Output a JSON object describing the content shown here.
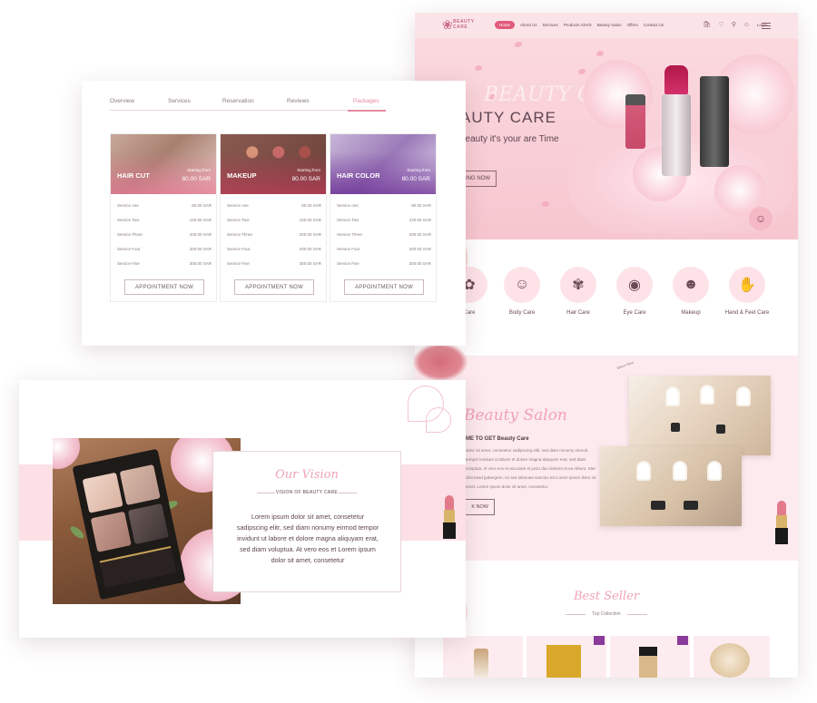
{
  "home": {
    "logo_text": "BEAUTY CARE",
    "nav": [
      "Home",
      "About Us",
      "Services",
      "Products ADVS",
      "Beauty Salon",
      "Offers",
      "Contact Us"
    ],
    "login": "Login",
    "hero_bg_word": "BEAUTY CARE",
    "hero_title": "AUTY CARE",
    "hero_subtitle": "beauty it's your are Time",
    "hero_button": "KING NOW",
    "categories": [
      "Care",
      "Body Care",
      "Hair Care",
      "Eye Care",
      "Makeup",
      "Hand & Feet Care"
    ],
    "salon_script": "Beauty Salon",
    "salon_heading": "ME TO GET Beauty Care",
    "salon_body": "dolor sit amet, consetetur sadipscing elitr, sed diam nonumy eirmod tempor invidunt ut labore et dolore magna aliquyam erat, sed diam voluptua. At vero eos et accusam et justo duo dolores et ea rebum. Stet clita kasd gubergren, no sea takimata sanctus est Lorem ipsum dolor sit amet. Lorem ipsum dolor sit amet, consetetur",
    "salon_button": "K NOW",
    "badge_text": "Since Now",
    "best_script": "Best Seller",
    "best_sub": "Top Collection",
    "colors": {
      "accent": "#e05a7a",
      "pink_bg": "#fbe4e8",
      "script": "#f0a3b5"
    }
  },
  "services": {
    "tabs": [
      "Overview",
      "Services",
      "Reservation",
      "Reviews",
      "Packages"
    ],
    "active_tab": "Packages",
    "packages": [
      {
        "name": "HAIR CUT",
        "from": "Starting from",
        "price": "80.00 SAR",
        "rows": [
          [
            "Service one",
            "80.00 SAR"
          ],
          [
            "Service Two",
            "120.00 SAR"
          ],
          [
            "Service Three",
            "200.00 SAR"
          ],
          [
            "Service Four",
            "200.00 SAR"
          ],
          [
            "Service Five",
            "300.00 SAR"
          ]
        ],
        "button": "APPOINTMENT NOW"
      },
      {
        "name": "MAKEUP",
        "from": "Starting from",
        "price": "80.00 SAR",
        "rows": [
          [
            "Service one",
            "80.00 SAR"
          ],
          [
            "Service Two",
            "120.00 SAR"
          ],
          [
            "Service Three",
            "200.00 SAR"
          ],
          [
            "Service Four",
            "200.00 SAR"
          ],
          [
            "Service Five",
            "300.00 SAR"
          ]
        ],
        "button": "APPOINTMENT NOW"
      },
      {
        "name": "HAIR COLOR",
        "from": "Starting from",
        "price": "80.00 SAR",
        "rows": [
          [
            "Service one",
            "80.00 SAR"
          ],
          [
            "Service Two",
            "120.00 SAR"
          ],
          [
            "Service Three",
            "200.00 SAR"
          ],
          [
            "Service Four",
            "200.00 SAR"
          ],
          [
            "Service Five",
            "300.00 SAR"
          ]
        ],
        "button": "APPOINTMENT NOW"
      }
    ]
  },
  "vision": {
    "script": "Our Vision",
    "subtitle": "VISION OF BEAUTY CARE",
    "text": "Lorem ipsum dolor sit amet, consetetur sadipscing elitr, sed diam nonumy eirmod tempor invidunt ut labore et dolore magna aliquyam erat, sed diam voluptua. At vero eos et Lorem ipsum dolor sit amet, consetetur"
  }
}
